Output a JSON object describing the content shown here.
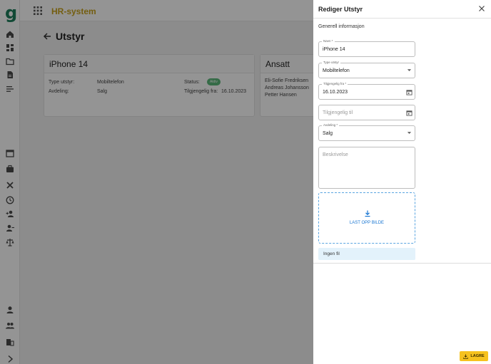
{
  "app": {
    "logo": "g",
    "title": "HR-system"
  },
  "page": {
    "title": "Utstyr"
  },
  "card_equipment": {
    "title": "iPhone 14",
    "type_label": "Type utstyr:",
    "type_value": "Mobiltelefon",
    "dept_label": "Avdeling:",
    "dept_value": "Salg",
    "status_label": "Status:",
    "status_value": "Aktiv",
    "available_label": "Tilgjengelig fra:",
    "available_value": "16.10.2023"
  },
  "card_employees": {
    "title": "Ansatt",
    "names": [
      "Eli-Sofie Fredriksen",
      "Andreas Johansson",
      "Petter Hansen"
    ]
  },
  "drawer": {
    "title": "Rediger Utstyr",
    "section": "Generell informasjon",
    "name_label": "Navn *",
    "name_value": "iPhone 14",
    "type_label": "Type utstyr",
    "type_value": "Mobiltelefon",
    "from_label": "Tilgjengelig fra *",
    "from_value": "16.10.2023",
    "to_placeholder": "Tilgjengelig til",
    "dept_label": "Avdeling *",
    "dept_value": "Salg",
    "desc_placeholder": "Beskrivelse",
    "upload_label": "LAST OPP BILDE",
    "no_file": "Ingen fil",
    "save_label": "LAGRE"
  },
  "colors": {
    "accent": "#1976d2",
    "save": "#f6c21f",
    "status": "#5cb87a",
    "brand": "#1e7f5c"
  }
}
